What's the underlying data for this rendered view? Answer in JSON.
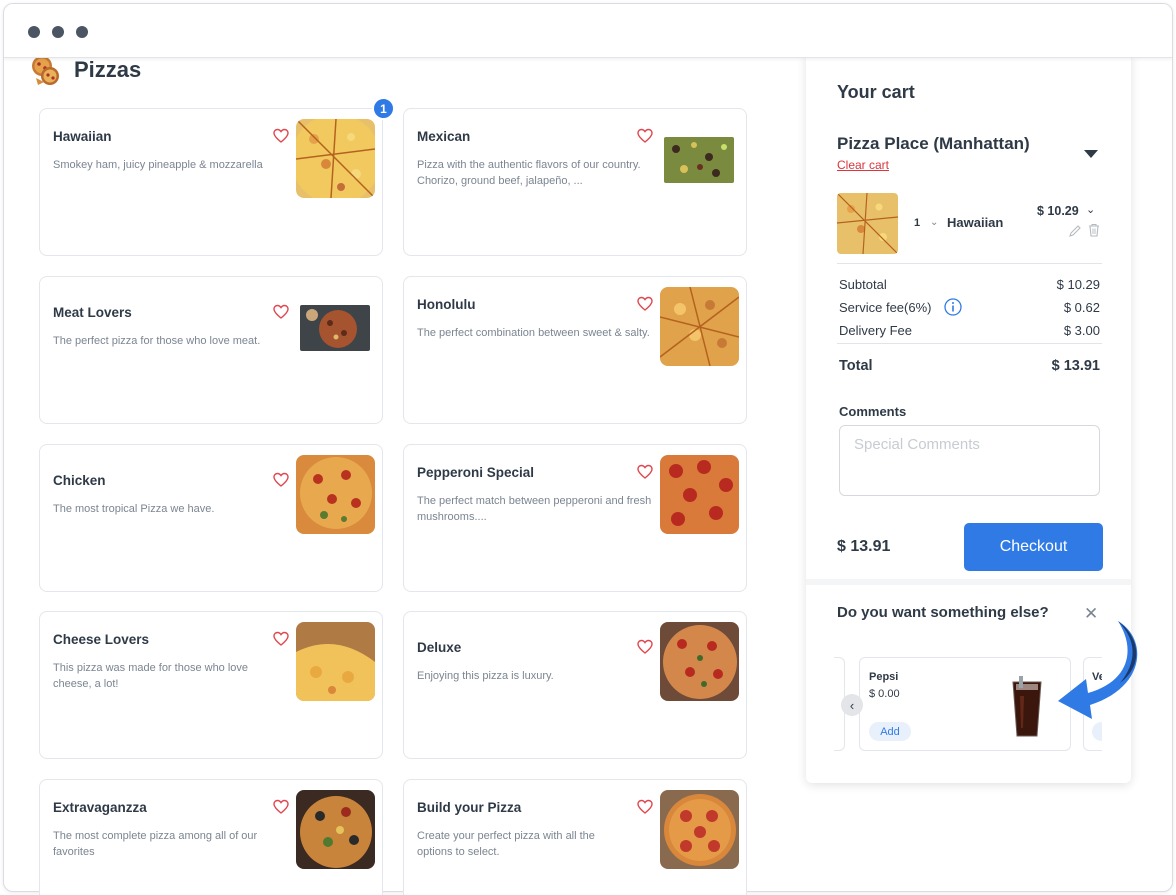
{
  "page": {
    "title": "Pizzas"
  },
  "menu": {
    "items": [
      {
        "name": "Hawaiian",
        "description": "Smokey ham, juicy pineapple & mozzarella"
      },
      {
        "name": "Mexican",
        "description": "Pizza with the authentic flavors of our country. Chorizo, ground beef, jalapeño, ..."
      },
      {
        "name": "Meat Lovers",
        "description": "The perfect pizza for those who love meat."
      },
      {
        "name": "Honolulu",
        "description": "The perfect combination between sweet & salty."
      },
      {
        "name": "Chicken",
        "description": "The most tropical Pizza we have."
      },
      {
        "name": "Pepperoni Special",
        "description": "The perfect match between pepperoni and fresh mushrooms...."
      },
      {
        "name": "Cheese Lovers",
        "description": "This pizza was made for those who love cheese, a lot!"
      },
      {
        "name": "Deluxe",
        "description": "Enjoying this pizza is luxury."
      },
      {
        "name": "Extravaganzza",
        "description": "The most complete pizza among all of our favorites"
      },
      {
        "name": "Build your Pizza",
        "description": "Create your perfect pizza with all the options to select."
      }
    ],
    "badge_count": "1"
  },
  "cart": {
    "title": "Your cart",
    "restaurant": "Pizza Place (Manhattan)",
    "clear_label": "Clear cart",
    "item": {
      "qty": "1",
      "qty_chevron": "⌄",
      "name": "Hawaiian",
      "price": "$ 10.29",
      "price_chevron": "⌄"
    },
    "subtotal_label": "Subtotal",
    "subtotal_value": "$ 10.29",
    "service_label": "Service fee(6%)",
    "service_value": "$ 0.62",
    "delivery_label": "Delivery Fee",
    "delivery_value": "$ 3.00",
    "total_label": "Total",
    "total_value": "$ 13.91",
    "comments_label": "Comments",
    "comments_placeholder": "Special Comments",
    "footer_total": "$ 13.91",
    "checkout_label": "Checkout"
  },
  "upsell": {
    "title": "Do you want something else?",
    "close": "✕",
    "prev": "‹",
    "items": [
      {
        "name": "Pepsi",
        "price": "$ 0.00",
        "add_label": "Add"
      },
      {
        "name": "Ve"
      }
    ]
  },
  "colors": {
    "accent": "#2f7ae5",
    "heart": "#e0474f",
    "danger": "#d9363e",
    "text": "#2f3a47",
    "muted": "#7b8591"
  }
}
